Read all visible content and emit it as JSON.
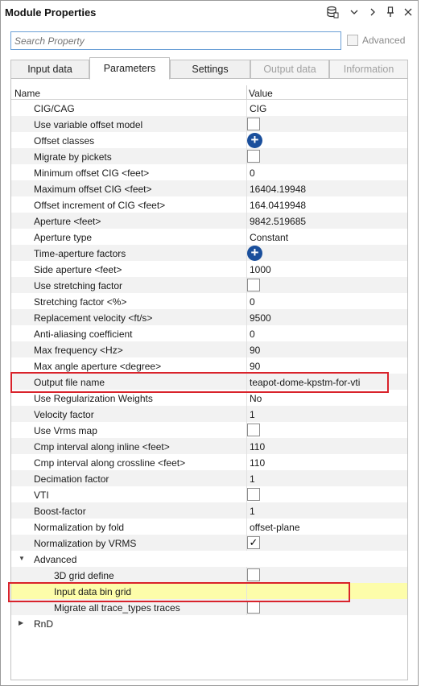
{
  "window": {
    "title": "Module Properties",
    "toolbar_icons": [
      "database-icon",
      "chevron-down-icon",
      "chevron-right-icon",
      "pin-icon",
      "close-icon"
    ]
  },
  "search": {
    "placeholder": "Search Property",
    "value": ""
  },
  "advanced_toggle": {
    "label": "Advanced",
    "checked": false,
    "enabled": false
  },
  "tabs": [
    {
      "label": "Input data",
      "active": false,
      "enabled": true
    },
    {
      "label": "Parameters",
      "active": true,
      "enabled": true
    },
    {
      "label": "Settings",
      "active": false,
      "enabled": true
    },
    {
      "label": "Output data",
      "active": false,
      "enabled": false
    },
    {
      "label": "Information",
      "active": false,
      "enabled": false
    }
  ],
  "grid": {
    "columns": [
      "Name",
      "Value"
    ],
    "rows": [
      {
        "name": "CIG/CAG",
        "value": "CIG",
        "type": "text"
      },
      {
        "name": "Use variable offset model",
        "type": "checkbox",
        "checked": false
      },
      {
        "name": "Offset classes",
        "type": "add"
      },
      {
        "name": "Migrate by pickets",
        "type": "checkbox",
        "checked": false
      },
      {
        "name": "Minimum offset CIG <feet>",
        "value": "0",
        "type": "text"
      },
      {
        "name": "Maximum offset CIG <feet>",
        "value": "16404.19948",
        "type": "text"
      },
      {
        "name": "Offset increment of CIG <feet>",
        "value": "164.0419948",
        "type": "text"
      },
      {
        "name": "Aperture <feet>",
        "value": "9842.519685",
        "type": "text"
      },
      {
        "name": "Aperture type",
        "value": "Constant",
        "type": "text"
      },
      {
        "name": "Time-aperture factors",
        "type": "add"
      },
      {
        "name": "Side aperture <feet>",
        "value": "1000",
        "type": "text"
      },
      {
        "name": "Use stretching factor",
        "type": "checkbox",
        "checked": false
      },
      {
        "name": "Stretching factor <%>",
        "value": "0",
        "type": "text"
      },
      {
        "name": "Replacement velocity <ft/s>",
        "value": "9500",
        "type": "text"
      },
      {
        "name": "Anti-aliasing coefficient",
        "value": "0",
        "type": "text"
      },
      {
        "name": "Max frequency <Hz>",
        "value": "90",
        "type": "text"
      },
      {
        "name": "Max angle aperture <degree>",
        "value": "90",
        "type": "text"
      },
      {
        "name": "Output file name",
        "value": "teapot-dome-kpstm-for-vti",
        "type": "text"
      },
      {
        "name": "Use Regularization Weights",
        "value": "No",
        "type": "text"
      },
      {
        "name": "Velocity factor",
        "value": "1",
        "type": "text"
      },
      {
        "name": "Use Vrms map",
        "type": "checkbox",
        "checked": false
      },
      {
        "name": "Cmp interval along inline <feet>",
        "value": "110",
        "type": "text"
      },
      {
        "name": "Cmp interval along crossline <feet>",
        "value": "110",
        "type": "text"
      },
      {
        "name": "Decimation factor",
        "value": "1",
        "type": "text"
      },
      {
        "name": "VTI",
        "type": "checkbox",
        "checked": false
      },
      {
        "name": "Boost-factor",
        "value": "1",
        "type": "text"
      },
      {
        "name": "Normalization by fold",
        "value": "offset-plane",
        "type": "text"
      },
      {
        "name": "Normalization by VRMS",
        "type": "checkbox",
        "checked": true
      },
      {
        "name": "Advanced",
        "type": "group",
        "expanded": true
      },
      {
        "name": "3D grid define",
        "type": "checkbox",
        "checked": false,
        "indent": 2
      },
      {
        "name": "Input data bin grid",
        "value": "",
        "type": "text",
        "indent": 2,
        "selected": true
      },
      {
        "name": "Migrate all trace_types traces",
        "type": "checkbox",
        "checked": false,
        "indent": 2
      },
      {
        "name": "RnD",
        "type": "group",
        "expanded": false
      }
    ]
  },
  "colors": {
    "highlight_row": "#fdfdaa",
    "annotation_box": "#d9232b",
    "add_button": "#1a4f9c"
  }
}
